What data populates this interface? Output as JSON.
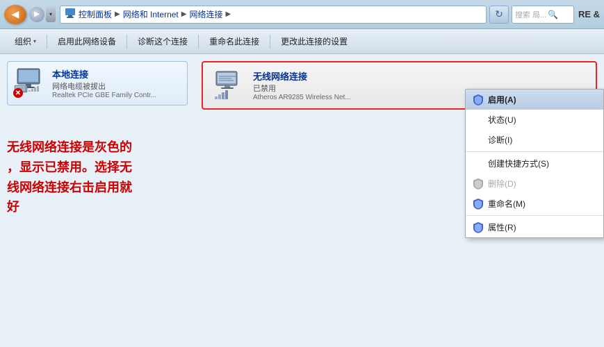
{
  "titlebar": {
    "back_icon": "◀",
    "forward_icon": "▶",
    "dropdown_icon": "▾",
    "breadcrumb": {
      "icon": "🖥",
      "parts": [
        "控制面板",
        "网络和 Internet",
        "网络连接"
      ]
    },
    "refresh_icon": "↻",
    "search_placeholder": "搜索 局...",
    "extra_label": "RE &"
  },
  "toolbar": {
    "buttons": [
      {
        "id": "organize",
        "label": "组织",
        "has_arrow": true
      },
      {
        "id": "enable-network",
        "label": "启用此网络设备",
        "has_arrow": false
      },
      {
        "id": "diagnose",
        "label": "诊断这个连接",
        "has_arrow": false
      },
      {
        "id": "rename",
        "label": "重命名此连接",
        "has_arrow": false
      },
      {
        "id": "change-settings",
        "label": "更改此连接的设置",
        "has_arrow": false
      }
    ]
  },
  "local_connection": {
    "name": "本地连接",
    "status": "网络电缆被拔出",
    "adapter": "Realtek PCIe GBE Family Contr...",
    "has_error": true,
    "error_symbol": "✕"
  },
  "wireless_connection": {
    "name": "无线网络连接",
    "status": "已禁用",
    "adapter": "Atheros AR9285 Wireless Net..."
  },
  "context_menu": {
    "items": [
      {
        "id": "enable",
        "label": "启用(A)",
        "has_shield": true,
        "highlighted": true
      },
      {
        "id": "status",
        "label": "状态(U)",
        "has_shield": false
      },
      {
        "id": "diagnose",
        "label": "诊断(I)",
        "has_shield": false
      },
      {
        "id": "sep1",
        "type": "separator"
      },
      {
        "id": "create-shortcut",
        "label": "创建快捷方式(S)",
        "has_shield": false
      },
      {
        "id": "delete",
        "label": "删除(D)",
        "has_shield": true,
        "disabled": true
      },
      {
        "id": "rename",
        "label": "重命名(M)",
        "has_shield": true
      },
      {
        "id": "sep2",
        "type": "separator"
      },
      {
        "id": "properties",
        "label": "属性(R)",
        "has_shield": true
      }
    ]
  },
  "annotation": {
    "text": "无线网络连接是灰色的\n，显示已禁用。选择无\n线网络连接右击启用就\n好"
  },
  "colors": {
    "accent_blue": "#003399",
    "error_red": "#cc0000",
    "annotation_red": "#cc0000",
    "highlight_border": "#ee2222",
    "shield_blue": "#4466cc",
    "shield_yellow": "#ddaa00"
  }
}
